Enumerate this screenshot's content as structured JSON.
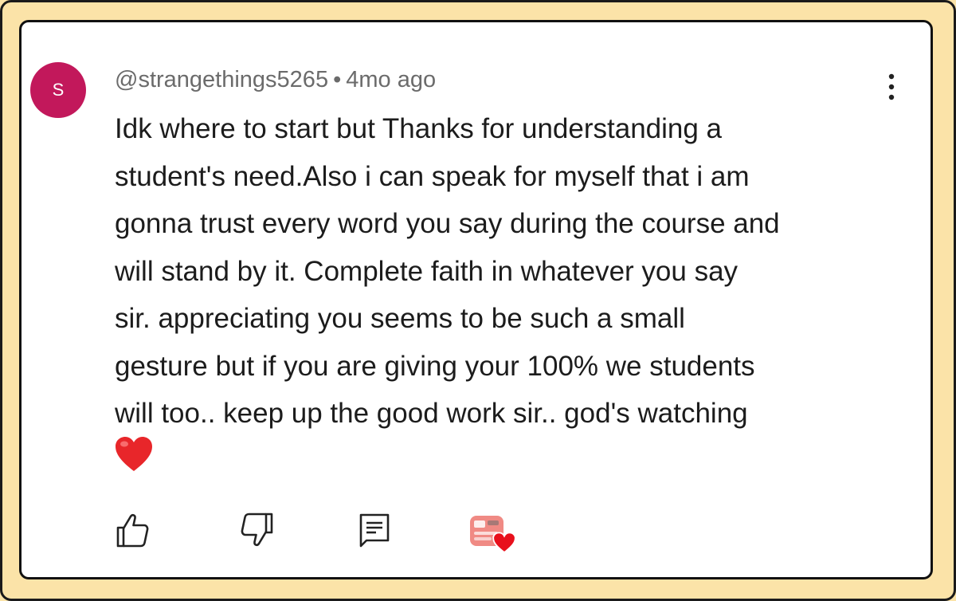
{
  "comment": {
    "avatar_letter": "S",
    "avatar_color": "#c2185b",
    "author": "@strangethings5265",
    "separator": "•",
    "time": "4mo ago",
    "body_lines": [
      "Idk where to start but Thanks for understanding a",
      "student's need.Also i can speak for myself that i am",
      "gonna trust every word you say during the course and",
      "will stand by it. Complete faith in whatever you say",
      "sir. appreciating you seems to be such a small",
      "gesture but if you are giving your 100% we students",
      "will too.. keep up the good work sir.. god's watching"
    ],
    "emoji": "red-heart-emoji"
  },
  "actions": {
    "like_icon": "thumbs-up-icon",
    "dislike_icon": "thumbs-down-icon",
    "reply_icon": "reply-comment-icon",
    "creator_heart_icon": "creator-heart-badge"
  },
  "colors": {
    "background": "#fbe3a8",
    "card": "#ffffff",
    "text": "#1c1c1c",
    "meta_text": "#6b6b6b",
    "heart": "#e8262a"
  }
}
